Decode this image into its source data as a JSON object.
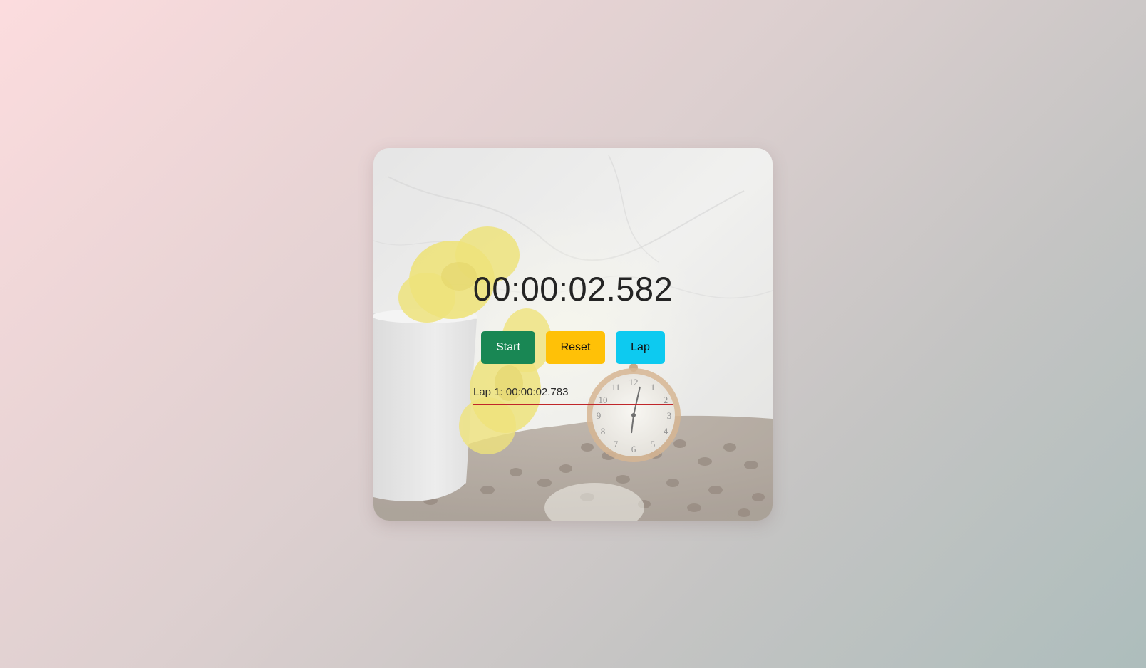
{
  "stopwatch": {
    "time": "00:00:02.582",
    "buttons": {
      "start_label": "Start",
      "reset_label": "Reset",
      "lap_label": "Lap"
    },
    "laps": [
      {
        "label": "Lap 1: 00:00:02.783"
      }
    ]
  },
  "colors": {
    "start": "#198754",
    "reset": "#ffc107",
    "lap": "#0dcaf0",
    "lap_divider": "#c0262a"
  },
  "background_image": "marble wall, yellow chrysanthemum in white cup, pocket watch on coffee beans"
}
